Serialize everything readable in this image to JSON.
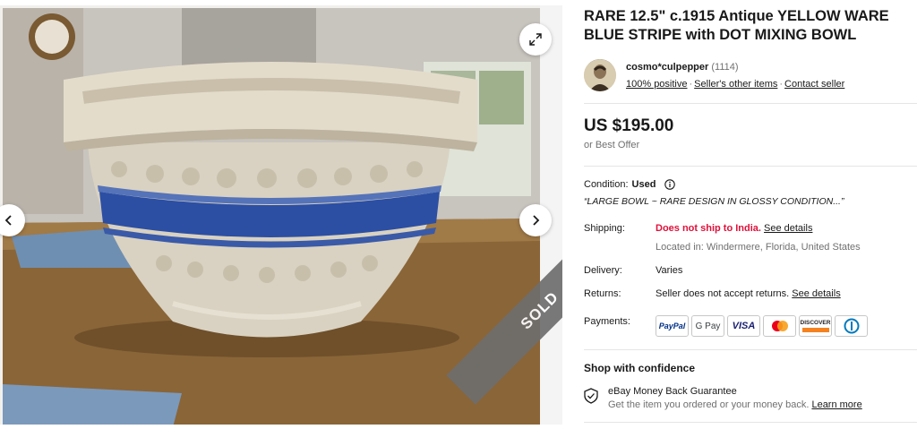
{
  "listing": {
    "title": "RARE 12.5\" c.1915 Antique YELLOW WARE BLUE STRIPE with DOT MIXING BOWL",
    "sold_badge": "SOLD"
  },
  "seller": {
    "name": "cosmo*culpepper",
    "feedback_count": "(1114)",
    "positive": "100% positive",
    "other_items": "Seller's other items",
    "contact": "Contact seller"
  },
  "price": {
    "amount": "US $195.00",
    "best_offer": "or Best Offer"
  },
  "condition": {
    "label": "Condition:",
    "value": "Used",
    "description": "“LARGE BOWL ~ RARE DESIGN IN GLOSSY CONDITION...”"
  },
  "shipping": {
    "label": "Shipping:",
    "status": "Does not ship to India.",
    "details_link": "See details",
    "location": "Located in: Windermere, Florida, United States"
  },
  "delivery": {
    "label": "Delivery:",
    "value": "Varies"
  },
  "returns": {
    "label": "Returns:",
    "value": "Seller does not accept returns.",
    "details_link": "See details"
  },
  "payments": {
    "label": "Payments:",
    "methods": [
      "PayPal",
      "G Pay",
      "VISA",
      "Mastercard",
      "DISCOVER",
      "Diners Club"
    ]
  },
  "confidence": {
    "title": "Shop with confidence",
    "guarantee_title": "eBay Money Back Guarantee",
    "guarantee_desc": "Get the item you ordered or your money back.",
    "learn_more": "Learn more"
  },
  "colors": {
    "error_red": "#e0103a",
    "paypal_blue": "#003087",
    "visa_blue": "#1a1f71",
    "discover_orange": "#f58220"
  }
}
